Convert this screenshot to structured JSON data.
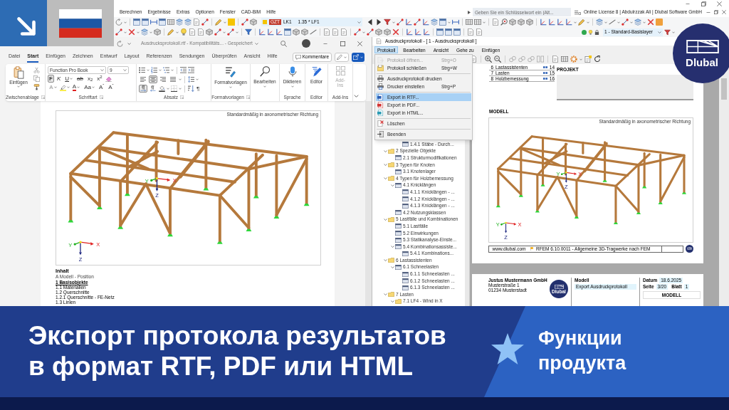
{
  "rfem": {
    "menu": [
      "Berechnen",
      "Ergebnisse",
      "Extras",
      "Optionen",
      "Fenster",
      "CAD-BIM",
      "Hilfe"
    ],
    "search": {
      "placeholder": "Geben Sie ein Schlüsselwort ein (Alt..."
    },
    "license": "Online License 8 | Abdulrzzak Ali | Dlubal Software GmbH",
    "load_case": {
      "type": "GZT",
      "name": "LK1",
      "combination": "1.35 * LF1"
    },
    "layer": "1 - Standard-Basislayer"
  },
  "word": {
    "title": "Ausdrucksprotokoll.rtf - Kompatibilitäts... - Gespeichert",
    "tabs": [
      {
        "label": "Datei",
        "selected": false
      },
      {
        "label": "Start",
        "selected": true
      },
      {
        "label": "Einfügen",
        "selected": false
      },
      {
        "label": "Zeichnen",
        "selected": false
      },
      {
        "label": "Entwurf",
        "selected": false
      },
      {
        "label": "Layout",
        "selected": false
      },
      {
        "label": "Referenzen",
        "selected": false
      },
      {
        "label": "Sendungen",
        "selected": false
      },
      {
        "label": "Überprüfen",
        "selected": false
      },
      {
        "label": "Ansicht",
        "selected": false
      },
      {
        "label": "Hilfe",
        "selected": false
      }
    ],
    "comment_button": "Kommentare",
    "ribbon": [
      {
        "kind": "clipboard",
        "label": "Zwischenablage",
        "button": "Einfügen"
      },
      {
        "kind": "font",
        "label": "Schriftart",
        "font": "Function Pro Book",
        "size": "9",
        "styles": [
          {
            "kind": "bold",
            "label": "F",
            "pressed": true
          },
          {
            "kind": "italic",
            "label": "K",
            "pressed": false
          },
          {
            "kind": "underline",
            "label": "U",
            "pressed": false
          },
          {
            "kind": "strike",
            "label": "ab",
            "pressed": false
          },
          {
            "kind": "sub",
            "label": "x$_{2}$",
            "pressed": false
          },
          {
            "kind": "sup",
            "label": "x$^{2}$",
            "pressed": false
          }
        ],
        "effects": [
          {
            "kind": "effects",
            "label": "A"
          },
          {
            "kind": "highlight"
          },
          {
            "kind": "color",
            "label": "A"
          },
          {
            "kind": "case",
            "label": "Aa"
          },
          {
            "kind": "grow",
            "label": "A$^{ˆ}$"
          },
          {
            "kind": "shrink",
            "label": "A$^{ˇ}$"
          }
        ]
      },
      {
        "kind": "paragraph",
        "label": "Absatz",
        "alignment": [
          {
            "selected": false
          },
          {
            "selected": true
          },
          {
            "selected": false
          },
          {
            "selected": false
          }
        ],
        "direction": [
          {
            "selected": true
          },
          {
            "selected": false
          }
        ],
        "mark": "¶"
      },
      {
        "kind": "styles",
        "label": "Formatvorlagen",
        "button": "Formatvorlagen"
      },
      {
        "kind": "editing",
        "button": "Bearbeiten"
      },
      {
        "kind": "voice",
        "label": "Sprache",
        "button": "Diktieren"
      },
      {
        "kind": "editor",
        "label": "Editor",
        "button": "Editor"
      },
      {
        "kind": "addins",
        "label": "Add-Ins",
        "button": "Add-Ins",
        "disabled": true
      }
    ],
    "document": {
      "figure": {
        "caption": "Standardmäßig in axonometrischer Richtung",
        "axes": [
          {
            "x": "X",
            "y": "Y",
            "z": "Z"
          },
          {
            "x": "X",
            "y": "Y",
            "z": "Z"
          }
        ]
      },
      "heading": "Inhalt",
      "toc": [
        {
          "text": "A Modell - Position",
          "kind": "line"
        },
        {
          "text": "1 Basisobjekte",
          "kind": "section"
        },
        {
          "text": "1.1 Materialien",
          "kind": "entry"
        },
        {
          "text": "1.2 Querschnitte",
          "kind": "entry"
        },
        {
          "text": "1.2.1 Querschnitte - FE-Netz",
          "kind": "entry"
        },
        {
          "text": "1.3 Linien",
          "kind": "entry"
        }
      ]
    }
  },
  "report": {
    "title": "Ausdruckprotokoll - [ 1 - Ausdrucksprotokoll ]",
    "menu": [
      {
        "label": "Protokoll",
        "selected": true
      },
      {
        "label": "Bearbeiten",
        "selected": false
      },
      {
        "label": "Ansicht",
        "selected": false
      },
      {
        "label": "Gehe zu",
        "selected": false
      },
      {
        "label": "Einfügen",
        "selected": false
      }
    ],
    "dropdown": [
      [
        {
          "kind": "open",
          "label": "Protokoll öffnen...",
          "shortcut": "Strg+O",
          "disabled": true,
          "selected": false
        },
        {
          "kind": "close",
          "label": "Protokoll schließen",
          "shortcut": "Strg+W",
          "disabled": false,
          "selected": false
        }
      ],
      [
        {
          "kind": "print",
          "label": "Ausdruckprotokoll drucken",
          "disabled": false,
          "selected": false
        },
        {
          "kind": "printer",
          "label": "Drucker einstellen",
          "shortcut": "Strg+P",
          "disabled": false,
          "selected": false
        }
      ],
      [
        {
          "kind": "rtf",
          "label": "Export in RTF...",
          "disabled": false,
          "selected": true
        },
        {
          "kind": "pdf",
          "label": "Export in PDF...",
          "disabled": false,
          "selected": false
        },
        {
          "kind": "html",
          "label": "Export in HTML...",
          "disabled": false,
          "selected": false
        }
      ],
      [
        {
          "kind": "delete",
          "label": "Löschen",
          "disabled": false,
          "selected": false
        }
      ],
      [
        {
          "kind": "exit",
          "label": "Beenden",
          "disabled": false,
          "selected": false
        }
      ]
    ],
    "tree_continued": [
      {
        "label": "1.4.1 Stäbe - Durch...",
        "kind": "page"
      }
    ],
    "tree": [
      {
        "label": "2 Spezielle Objekte",
        "kind": "folder",
        "expanded": true,
        "children": [
          {
            "label": "2.1 Strukturmodifikationen",
            "kind": "page"
          }
        ]
      },
      {
        "label": "3 Typen für Knoten",
        "kind": "folder",
        "expanded": true,
        "children": [
          {
            "label": "3.1 Knotenlager",
            "kind": "page"
          }
        ]
      },
      {
        "label": "4 Typen für Holzbemessung",
        "kind": "folder",
        "expanded": true,
        "children": [
          {
            "label": "4.1 Knicklängen",
            "kind": "page",
            "expanded": true,
            "children": [
              {
                "label": "4.1.1 Knicklängen - ...",
                "kind": "page"
              },
              {
                "label": "4.1.2 Knicklängen - ...",
                "kind": "page"
              },
              {
                "label": "4.1.3 Knicklängen - ...",
                "kind": "page"
              }
            ]
          },
          {
            "label": "4.2 Nutzungsklassen",
            "kind": "page"
          }
        ]
      },
      {
        "label": "5 Lastfälle und Kombinationen",
        "kind": "folder",
        "expanded": true,
        "children": [
          {
            "label": "5.1 Lastfälle",
            "kind": "page"
          },
          {
            "label": "5.2 Einwirkungen",
            "kind": "page"
          },
          {
            "label": "5.3 Statikanalyse-Einste...",
            "kind": "page"
          },
          {
            "label": "5.4 Kombinationsassiste...",
            "kind": "page",
            "expanded": true,
            "children": [
              {
                "label": "5.4.1 Kombinations...",
                "kind": "page"
              }
            ]
          }
        ]
      },
      {
        "label": "6 Lastassistenten",
        "kind": "folder",
        "expanded": true,
        "children": [
          {
            "label": "6.1 Schneelasten",
            "kind": "page",
            "expanded": true,
            "children": [
              {
                "label": "6.1.1 Schneelasten ...",
                "kind": "page"
              },
              {
                "label": "6.1.2 Schneelasten ...",
                "kind": "page"
              },
              {
                "label": "6.1.3 Schneelasten ...",
                "kind": "page"
              }
            ]
          }
        ]
      },
      {
        "label": "7 Lasten",
        "kind": "folder",
        "expanded": true,
        "children": [
          {
            "label": "7.1 LF4 - Wind in X",
            "kind": "folder",
            "expanded": true
          }
        ]
      }
    ],
    "preview": {
      "toc": [
        {
          "number": "6",
          "label": "Lastassistenten",
          "page": "14"
        },
        {
          "number": "7",
          "label": "Lasten",
          "page": "15"
        },
        {
          "number": "8",
          "label": "Holzbemessung",
          "page": "16"
        }
      ],
      "project": "PROJEKT",
      "model": "MODELL",
      "figure": {
        "caption": "Standardmäßig in axonometrischer Richtung",
        "axes": [
          {
            "x": "X",
            "y": "Y",
            "z": "Z"
          },
          {
            "x": "X",
            "y": "Y",
            "z": "Z"
          }
        ]
      },
      "footer": {
        "url": "www.dlubal.com",
        "program": "RFEM 6.10.0011 - Allgemeine 3D-Tragwerke nach FEM"
      },
      "next_page": {
        "company": "Justus Mustermann GmbH",
        "street": "Musterstraße 1",
        "city": "01234 Musterstadt",
        "logo": "Dlubal",
        "model_label": "Modell",
        "model": "Export Ausdruckprotokoll",
        "date_label": "Datum",
        "date": "18.6.2025",
        "page_label": "Seite",
        "page": "3/20",
        "sheet_label": "Blatt",
        "sheet": "1",
        "section": "MODELL"
      }
    }
  },
  "logo": {
    "text": "Dlubal"
  },
  "banner": {
    "title": [
      "Экспорт протокола результатов",
      "в формат RTF, PDF или HTML"
    ],
    "tag": [
      "Функции",
      "продукта"
    ]
  }
}
